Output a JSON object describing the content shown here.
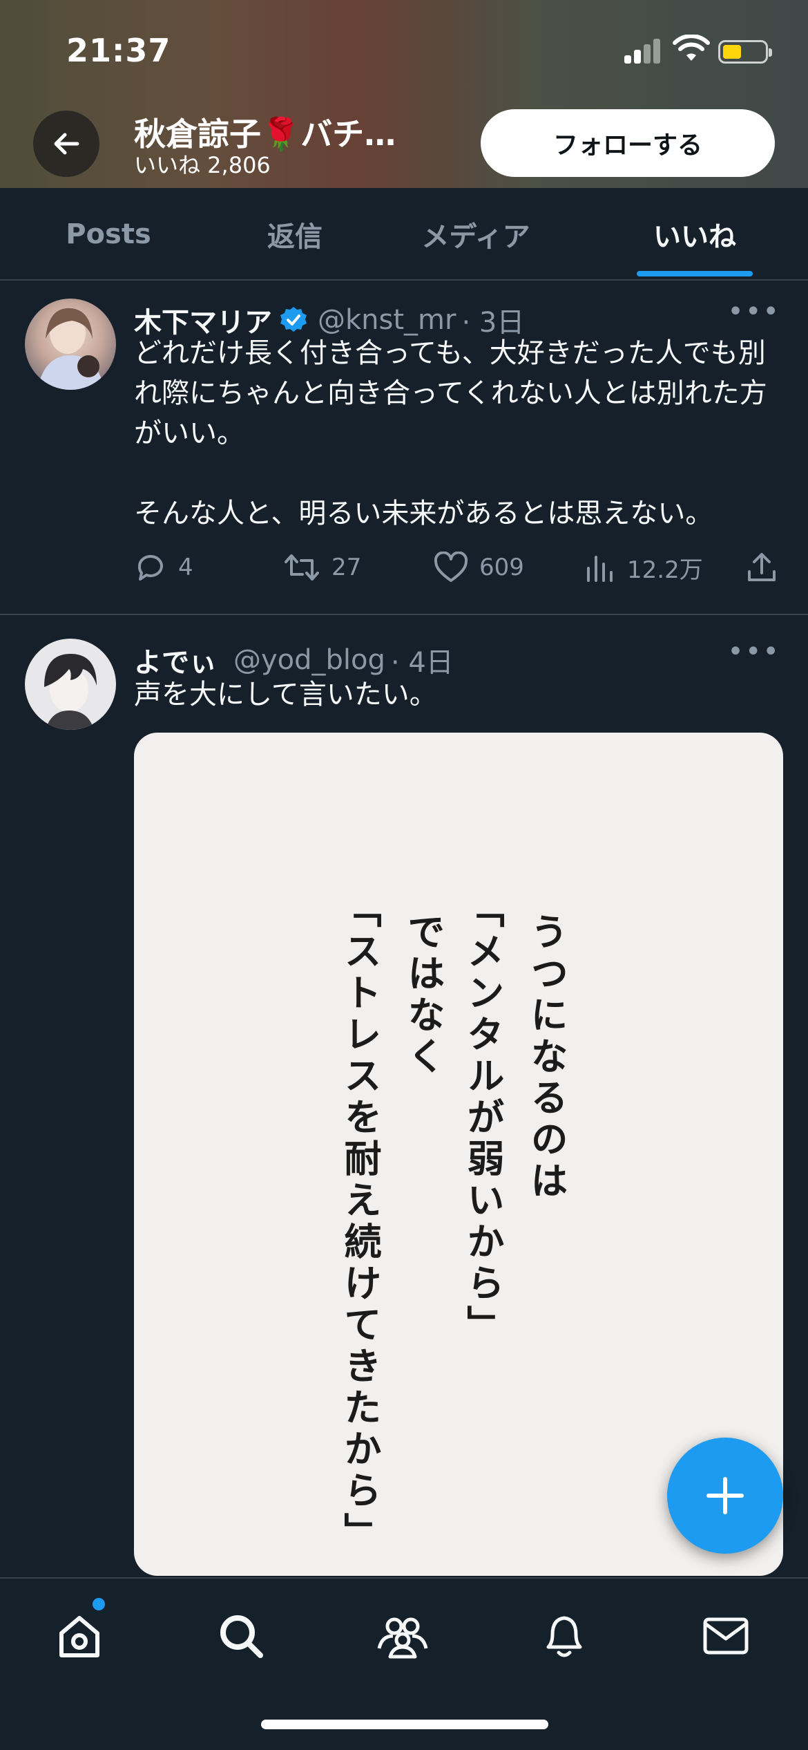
{
  "status_bar": {
    "time": "21:37"
  },
  "header": {
    "profile_name": "秋倉諒子🌹バチ…",
    "likes_count": "いいね 2,806",
    "follow_label": "フォローする"
  },
  "tabs": [
    {
      "label": "Posts"
    },
    {
      "label": "返信"
    },
    {
      "label": "メディア"
    },
    {
      "label": "いいね",
      "active": true
    }
  ],
  "posts": [
    {
      "name": "木下マリア",
      "verified": true,
      "handle": "@knst_mr",
      "time": "· 3日",
      "text": "どれだけ長く付き合っても、大好きだった人でも別れ際にちゃんと向き合ってくれない人とは別れた方がいい。\n\nそんな人と、明るい未来があるとは思えない。",
      "replies": "4",
      "reposts": "27",
      "likes": "609",
      "views": "12.2万"
    },
    {
      "name": "よでぃ",
      "handle": "@yod_blog",
      "time": "· 4日",
      "text": "声を大にして言いたい。",
      "image_lines": [
        "うつになるのは",
        "「メンタルが弱いから」",
        "ではなく",
        "「ストレスを耐え続けてきたから」"
      ]
    }
  ],
  "icons": {
    "back": "arrow-left-icon",
    "more": "more-dots-icon",
    "verified": "verified-badge-icon",
    "fab": "plus-icon",
    "nav": [
      "home-icon",
      "search-icon",
      "communities-icon",
      "bell-icon",
      "mail-icon"
    ]
  },
  "colors": {
    "accent": "#1d9bf0",
    "background": "#15202b",
    "muted": "#8b98a5"
  }
}
